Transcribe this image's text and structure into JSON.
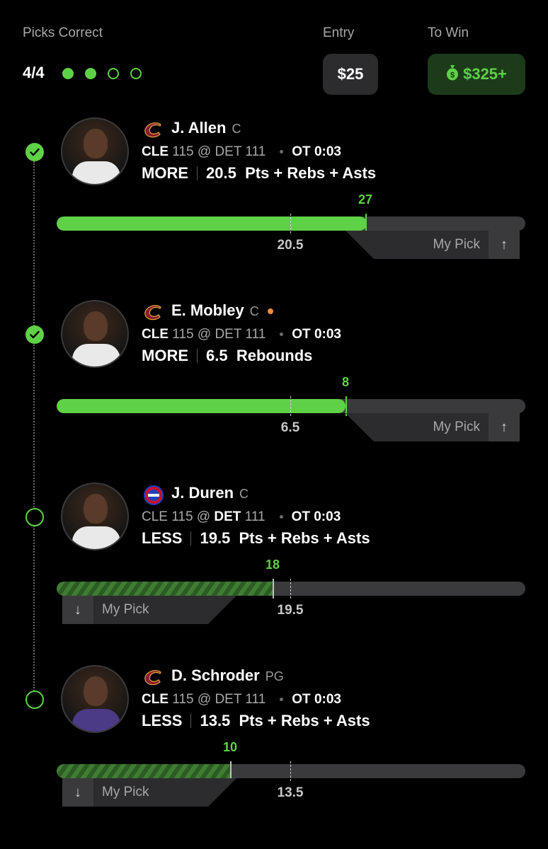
{
  "header": {
    "picks_label": "Picks Correct",
    "picks_score": "4/4",
    "entry_label": "Entry",
    "entry_value": "$25",
    "to_win_label": "To Win",
    "to_win_value": "$325+",
    "progress_dots": [
      "filled",
      "filled",
      "empty",
      "empty"
    ]
  },
  "colors": {
    "accent": "#5fd147",
    "win_bg": "#1d3b1a",
    "card": "#2c2c2e",
    "track": "#3a3a3c"
  },
  "picks": [
    {
      "player": "J. Allen",
      "position": "C",
      "team_logo": "cavaliers-logo",
      "game_away": "CLE",
      "away_score": "115",
      "at": "@",
      "game_home": "DET",
      "home_score": "111",
      "game_clock": "OT 0:03",
      "direction": "MORE",
      "line": "20.5",
      "stat": "Pts + Rebs + Asts",
      "actual": "27",
      "my_pick": "My Pick",
      "status": "hit"
    },
    {
      "player": "E. Mobley",
      "position": "C",
      "team_logo": "cavaliers-logo",
      "game_away": "CLE",
      "away_score": "115",
      "at": "@",
      "game_home": "DET",
      "home_score": "111",
      "game_clock": "OT 0:03",
      "direction": "MORE",
      "line": "6.5",
      "stat": "Rebounds",
      "actual": "8",
      "my_pick": "My Pick",
      "status": "hit"
    },
    {
      "player": "J. Duren",
      "position": "C",
      "team_logo": "pistons-logo",
      "game_away": "CLE",
      "away_score": "115",
      "at": "@",
      "game_home": "DET",
      "home_score": "111",
      "game_clock": "OT 0:03",
      "direction": "LESS",
      "line": "19.5",
      "stat": "Pts + Rebs + Asts",
      "actual": "18",
      "my_pick": "My Pick",
      "status": "pending"
    },
    {
      "player": "D. Schroder",
      "position": "PG",
      "team_logo": "cavaliers-logo",
      "game_away": "CLE",
      "away_score": "115",
      "at": "@",
      "game_home": "DET",
      "home_score": "111",
      "game_clock": "OT 0:03",
      "direction": "LESS",
      "line": "13.5",
      "stat": "Pts + Rebs + Asts",
      "actual": "10",
      "my_pick": "My Pick",
      "status": "pending"
    }
  ]
}
